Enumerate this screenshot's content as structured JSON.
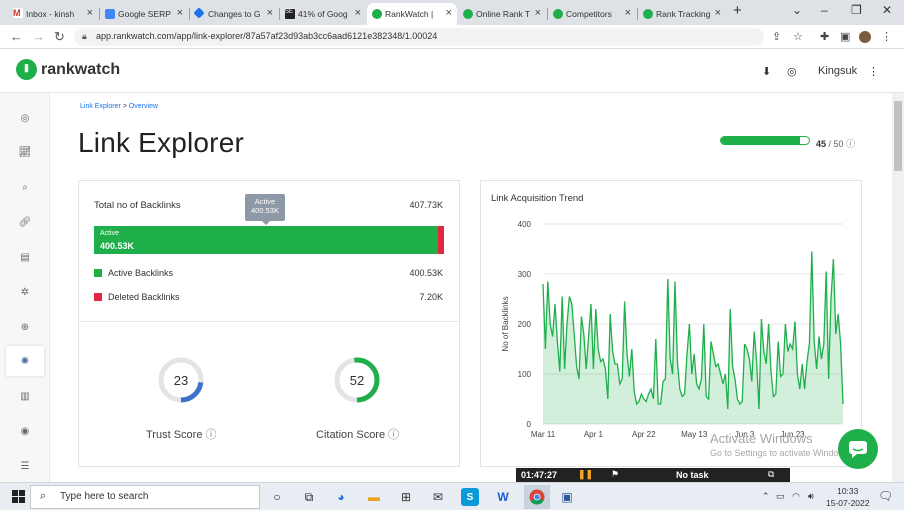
{
  "browser": {
    "tabs": [
      {
        "label": "Inbox - kinsh",
        "icon": "gmail-icon",
        "color": "#d93025"
      },
      {
        "label": "Google SERP",
        "icon": "doc-icon",
        "color": "#4285f4"
      },
      {
        "label": "Changes to G",
        "icon": "diamond-icon",
        "color": "#1a73e8"
      },
      {
        "label": "41% of Goog",
        "icon": "seo-icon",
        "color": "#222222"
      },
      {
        "label": "RankWatch |",
        "icon": "rankwatch-icon",
        "color": "#1eaf4b"
      },
      {
        "label": "Online Rank T",
        "icon": "rankwatch-icon",
        "color": "#1eaf4b"
      },
      {
        "label": "Competitors",
        "icon": "rankwatch-icon",
        "color": "#1eaf4b"
      },
      {
        "label": "Rank Tracking",
        "icon": "rankwatch-icon",
        "color": "#1eaf4b"
      }
    ],
    "url": "app.rankwatch.com/app/link-explorer/87a57af23d93ab3cc6aad6121e382348/1.00024"
  },
  "header": {
    "brand": "rankwatch",
    "user": "Kingsuk"
  },
  "main": {
    "breadcrumb_link": "Link Explorer",
    "breadcrumb_sep": ">",
    "breadcrumb_current": "Overview",
    "title": "Link Explorer",
    "quota_used": 45,
    "quota_total": 50,
    "quota_used_label": "45",
    "quota_total_label": "/ 50"
  },
  "backlinks": {
    "title": "Total no of Backlinks",
    "total": "407.73K",
    "tooltip_label": "Active",
    "tooltip_value": "400.53K",
    "bar_label": "Active",
    "bar_value": "400.53K",
    "active_fraction": 0.982,
    "active_label": "Active Backlinks",
    "active_value": "400.53K",
    "deleted_label": "Deleted Backlinks",
    "deleted_value": "7.20K",
    "active_color": "#1eaf4b",
    "deleted_color": "#e3273b"
  },
  "scores": {
    "trust_label": "Trust Score",
    "trust_value": "23",
    "trust_fraction": 0.23,
    "trust_color": "#3c73c9",
    "citation_label": "Citation Score",
    "citation_value": "52",
    "citation_fraction": 0.52,
    "citation_color": "#1eaf4b"
  },
  "chart_data": {
    "type": "area",
    "title": "Link Acquisition Trend",
    "ylabel": "No of Backlinks",
    "xlabel": "",
    "ylim": [
      0,
      400
    ],
    "yticks": [
      "0",
      "100",
      "200",
      "300",
      "400"
    ],
    "xticks": [
      "Mar 11",
      "Apr 1",
      "Apr 22",
      "May 13",
      "Jun 3",
      "Jun 23"
    ],
    "grid": true,
    "color": "#1eaf4b",
    "values": [
      280,
      150,
      285,
      200,
      175,
      240,
      165,
      105,
      255,
      110,
      200,
      255,
      240,
      180,
      115,
      90,
      215,
      180,
      110,
      175,
      240,
      110,
      230,
      150,
      125,
      130,
      110,
      50,
      220,
      145,
      120,
      120,
      80,
      90,
      245,
      140,
      95,
      150,
      65,
      40,
      45,
      60,
      50,
      45,
      60,
      70,
      50,
      170,
      40,
      40,
      85,
      90,
      290,
      130,
      100,
      285,
      125,
      70,
      55,
      60,
      140,
      200,
      100,
      140,
      80,
      70,
      90,
      200,
      55,
      50,
      165,
      140,
      115,
      120,
      100,
      80,
      100,
      30,
      230,
      115,
      90,
      50,
      40,
      45,
      160,
      150,
      130,
      85,
      185,
      125,
      30,
      210,
      145,
      120,
      200,
      105,
      55,
      60,
      165,
      95,
      100,
      200,
      145,
      160,
      150,
      205,
      100,
      70,
      120,
      70,
      125,
      160,
      345,
      165,
      110,
      175,
      130,
      160,
      305,
      90,
      250,
      330,
      180,
      220,
      160,
      40
    ]
  },
  "taskbar": {
    "search_placeholder": "Type here to search",
    "time": "10:33",
    "date": "15-07-2022"
  },
  "timer": {
    "elapsed": "01:47:27",
    "task": "No task"
  },
  "watermark": {
    "line1": "Activate Windows",
    "line2": "Go to Settings to activate Windows."
  }
}
